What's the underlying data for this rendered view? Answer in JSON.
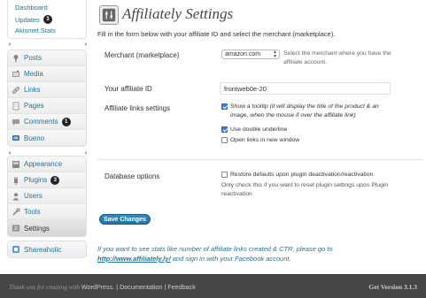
{
  "sidebar": {
    "top_submenu": [
      {
        "label": "Dashboard"
      },
      {
        "label": "Updates",
        "badge": "3"
      },
      {
        "label": "Akismet Stats"
      }
    ],
    "group1": [
      {
        "label": "Posts",
        "icon": "pin-icon"
      },
      {
        "label": "Media",
        "icon": "media-icon"
      },
      {
        "label": "Links",
        "icon": "link-icon"
      },
      {
        "label": "Pages",
        "icon": "page-icon"
      },
      {
        "label": "Comments",
        "icon": "comment-icon",
        "badge": "1"
      },
      {
        "label": "Bueno",
        "icon": "bueno-icon"
      }
    ],
    "group2": [
      {
        "label": "Appearance",
        "icon": "appearance-icon"
      },
      {
        "label": "Plugins",
        "icon": "plugin-icon",
        "badge": "3"
      },
      {
        "label": "Users",
        "icon": "users-icon"
      },
      {
        "label": "Tools",
        "icon": "tools-icon"
      },
      {
        "label": "Settings",
        "icon": "settings-icon",
        "current": true
      }
    ],
    "group3": [
      {
        "label": "Shareaholic",
        "icon": "shareaholic-icon"
      }
    ]
  },
  "main": {
    "title": "Affiliately Settings",
    "intro": "Fill in the form below with your affiliate ID and select the merchant (marketplace).",
    "merchant": {
      "label": "Merchant (marketplace)",
      "selected": "amazon.com",
      "help_line1": "Select the merchant where you have the",
      "help_line2": "affiliate account."
    },
    "affiliate_id": {
      "label": "Your affiliate ID",
      "value": "frontweb0e-20"
    },
    "links_settings": {
      "label": "Affiliate links settings",
      "tooltip_prefix": "Show a tooltip ",
      "tooltip_italic1": "(it will display the title of the product & an",
      "tooltip_italic2": "image, when the mouse if over the affiliate link)",
      "double_underline": "Use double underline",
      "new_window": "Open links in new window"
    },
    "database": {
      "label": "Database options",
      "restore": "Restore defaults upon plugin deactivation/reactivation",
      "help_line1": "Only check this if you want to reset plugin settings upon Plugin",
      "help_line2": "reactivation"
    },
    "save_button": "Save Changes",
    "promo_line1": "If you want to see stats like number of affiliate links created & CTR, please go to",
    "promo_link": "http://www.affiliately.ly/",
    "promo_line2_rest": " and sign in with your Facebook account."
  },
  "footer": {
    "thanks_prefix": "Thank you for creating with ",
    "wordpress": "WordPress",
    "sep1": ". | ",
    "documentation": "Documentation",
    "sep2": " | ",
    "feedback": "Feedback",
    "version": "Get Version 3.1.3"
  }
}
